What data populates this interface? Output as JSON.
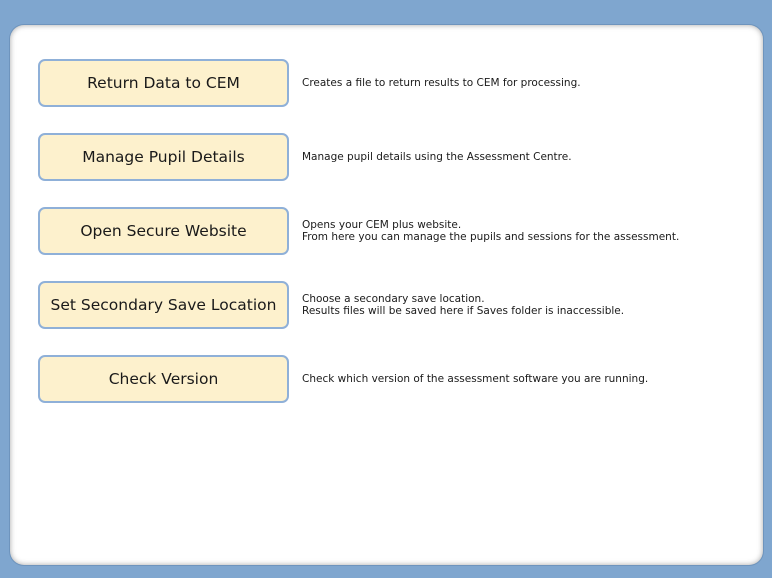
{
  "colors": {
    "background": "#7fa6cf",
    "panel": "#ffffff",
    "button_fill": "#fdf1cd",
    "button_border": "#8fb0d8"
  },
  "menu": [
    {
      "label": "Return Data to CEM",
      "description": [
        "Creates a file to return results to CEM for processing."
      ]
    },
    {
      "label": "Manage Pupil Details",
      "description": [
        "Manage pupil details using the Assessment Centre."
      ]
    },
    {
      "label": "Open Secure Website",
      "description": [
        "Opens your CEM plus website.",
        "From here you can manage the pupils and sessions for the assessment."
      ]
    },
    {
      "label": "Set Secondary Save Location",
      "description": [
        "Choose a secondary save location.",
        "Results files will be saved here if Saves folder is inaccessible."
      ]
    },
    {
      "label": "Check Version",
      "description": [
        "Check which version of the assessment software you are running."
      ]
    }
  ]
}
